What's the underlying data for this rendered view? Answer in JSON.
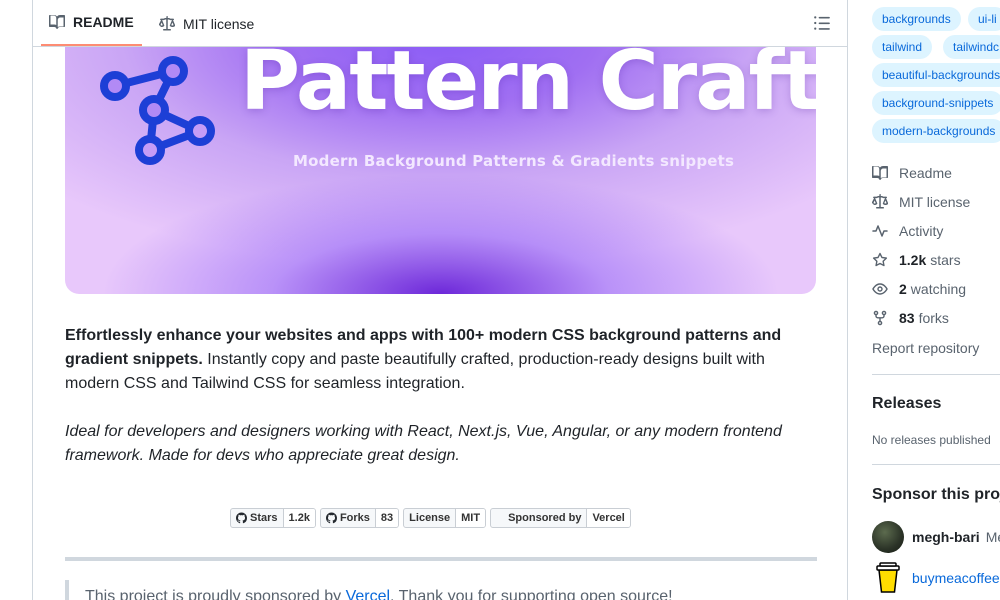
{
  "readme": {
    "tabs": [
      {
        "label": "README",
        "icon": "book-icon",
        "active": true
      },
      {
        "label": "MIT license",
        "icon": "scale-icon",
        "active": false
      }
    ],
    "banner": {
      "title": "Pattern Craft",
      "subtitle": "Modern Background Patterns & Gradients snippets"
    },
    "description": {
      "bold": "Effortlessly enhance your websites and apps with 100+ modern CSS background patterns and gradient snippets.",
      "rest": " Instantly copy and paste beautifully crafted, production-ready designs built with modern CSS and Tailwind CSS for seamless integration."
    },
    "italic_note": "Ideal for developers and designers working with React, Next.js, Vue, Angular, or any modern frontend framework. Made for devs who appreciate great design.",
    "badges": [
      {
        "label": "Stars",
        "value": "1.2k",
        "icon": "github-icon"
      },
      {
        "label": "Forks",
        "value": "83",
        "icon": "github-icon"
      },
      {
        "label": "License",
        "value": "MIT"
      },
      {
        "label": "Sponsored by",
        "value": "Vercel",
        "icon": "vercel-icon"
      }
    ],
    "sponsor_quote": {
      "prefix": "This project is proudly sponsored by ",
      "link": "Vercel",
      "suffix": ". Thank you for supporting open source!"
    }
  },
  "sidebar": {
    "topics": [
      "backgrounds",
      "ui-li",
      "tailwind",
      "tailwindc",
      "beautiful-backgrounds",
      "background-snippets",
      "modern-backgrounds"
    ],
    "meta": {
      "readme": "Readme",
      "license": "MIT license",
      "activity": "Activity",
      "stars_count": "1.2k",
      "stars_label": "stars",
      "watching_count": "2",
      "watching_label": "watching",
      "forks_count": "83",
      "forks_label": "forks",
      "report": "Report repository"
    },
    "releases": {
      "heading": "Releases",
      "empty": "No releases published"
    },
    "sponsor": {
      "heading": "Sponsor this proje",
      "user": "megh-bari",
      "user_extra": "Me",
      "link": "buymeacoffee"
    }
  },
  "colors": {
    "accent": "#0969da",
    "topic_bg": "#ddf4ff",
    "active_tab_underline": "#fd8c73",
    "banner_purple": "#8b5cf6",
    "logo_blue": "#1d3fd6"
  }
}
